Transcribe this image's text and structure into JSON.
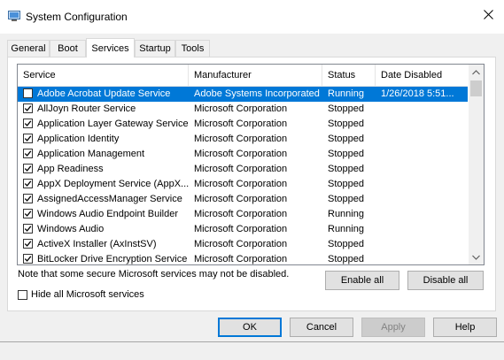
{
  "window": {
    "title": "System Configuration"
  },
  "tabs": [
    {
      "label": "General"
    },
    {
      "label": "Boot"
    },
    {
      "label": "Services"
    },
    {
      "label": "Startup"
    },
    {
      "label": "Tools"
    }
  ],
  "active_tab": "Services",
  "table": {
    "columns": [
      "Service",
      "Manufacturer",
      "Status",
      "Date Disabled"
    ],
    "rows": [
      {
        "checked": false,
        "selected": true,
        "service": "Adobe Acrobat Update Service",
        "manufacturer": "Adobe Systems Incorporated",
        "status": "Running",
        "date": "1/26/2018 5:51..."
      },
      {
        "checked": true,
        "selected": false,
        "service": "AllJoyn Router Service",
        "manufacturer": "Microsoft Corporation",
        "status": "Stopped",
        "date": ""
      },
      {
        "checked": true,
        "selected": false,
        "service": "Application Layer Gateway Service",
        "manufacturer": "Microsoft Corporation",
        "status": "Stopped",
        "date": ""
      },
      {
        "checked": true,
        "selected": false,
        "service": "Application Identity",
        "manufacturer": "Microsoft Corporation",
        "status": "Stopped",
        "date": ""
      },
      {
        "checked": true,
        "selected": false,
        "service": "Application Management",
        "manufacturer": "Microsoft Corporation",
        "status": "Stopped",
        "date": ""
      },
      {
        "checked": true,
        "selected": false,
        "service": "App Readiness",
        "manufacturer": "Microsoft Corporation",
        "status": "Stopped",
        "date": ""
      },
      {
        "checked": true,
        "selected": false,
        "service": "AppX Deployment Service (AppX...",
        "manufacturer": "Microsoft Corporation",
        "status": "Stopped",
        "date": ""
      },
      {
        "checked": true,
        "selected": false,
        "service": "AssignedAccessManager Service",
        "manufacturer": "Microsoft Corporation",
        "status": "Stopped",
        "date": ""
      },
      {
        "checked": true,
        "selected": false,
        "service": "Windows Audio Endpoint Builder",
        "manufacturer": "Microsoft Corporation",
        "status": "Running",
        "date": ""
      },
      {
        "checked": true,
        "selected": false,
        "service": "Windows Audio",
        "manufacturer": "Microsoft Corporation",
        "status": "Running",
        "date": ""
      },
      {
        "checked": true,
        "selected": false,
        "service": "ActiveX Installer (AxInstSV)",
        "manufacturer": "Microsoft Corporation",
        "status": "Stopped",
        "date": ""
      },
      {
        "checked": true,
        "selected": false,
        "service": "BitLocker Drive Encryption Service",
        "manufacturer": "Microsoft Corporation",
        "status": "Stopped",
        "date": ""
      }
    ]
  },
  "note": "Note that some secure Microsoft services may not be disabled.",
  "buttons": {
    "enable_all": "Enable all",
    "disable_all": "Disable all",
    "ok": "OK",
    "cancel": "Cancel",
    "apply": "Apply",
    "help": "Help"
  },
  "hide_ms": {
    "label": "Hide all Microsoft services",
    "checked": false
  },
  "icons": {
    "app": "system-config-icon",
    "close": "close-icon",
    "check": "checkmark-icon"
  },
  "colors": {
    "selection": "#0078d7",
    "default_button_border": "#0078d7"
  }
}
